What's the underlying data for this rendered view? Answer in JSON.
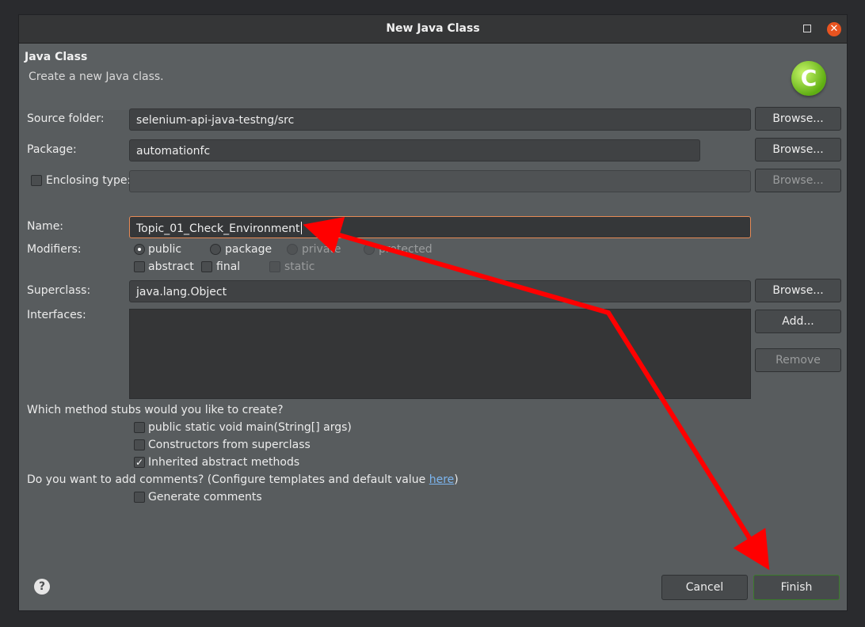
{
  "window": {
    "title": "New Java Class"
  },
  "header": {
    "title": "Java Class",
    "description": "Create a new Java class."
  },
  "source_folder": {
    "label": "Source folder:",
    "value": "selenium-api-java-testng/src",
    "button": "Browse..."
  },
  "package": {
    "label": "Package:",
    "value": "automationfc",
    "button": "Browse..."
  },
  "enclosing_type": {
    "label": "Enclosing type:",
    "value": "",
    "button": "Browse...",
    "checked": false
  },
  "name": {
    "label": "Name:",
    "value": "Topic_01_Check_Environment"
  },
  "modifiers": {
    "label": "Modifiers:",
    "radios": [
      "public",
      "package",
      "private",
      "protected"
    ],
    "selected": "public",
    "checks": [
      "abstract",
      "final",
      "static"
    ]
  },
  "superclass": {
    "label": "Superclass:",
    "value": "java.lang.Object",
    "button": "Browse..."
  },
  "interfaces": {
    "label": "Interfaces:",
    "add_button": "Add...",
    "remove_button": "Remove"
  },
  "stubs": {
    "question": "Which method stubs would you like to create?",
    "items": [
      {
        "label": "public static void main(String[] args)",
        "checked": false
      },
      {
        "label": "Constructors from superclass",
        "checked": false
      },
      {
        "label": "Inherited abstract methods",
        "checked": true
      }
    ]
  },
  "comments": {
    "question_prefix": "Do you want to add comments? (Configure templates and default value ",
    "link": "here",
    "question_suffix": ")",
    "generate_label": "Generate comments",
    "checked": false
  },
  "footer": {
    "cancel": "Cancel",
    "finish": "Finish"
  },
  "colors": {
    "accent_focus": "#e68a56",
    "annotation_arrow": "#ff0000",
    "close_button": "#e95420"
  },
  "icons": {
    "wizard": "java-class-wizard-icon",
    "help": "help-icon",
    "close": "close-icon",
    "maximize": "maximize-icon"
  }
}
